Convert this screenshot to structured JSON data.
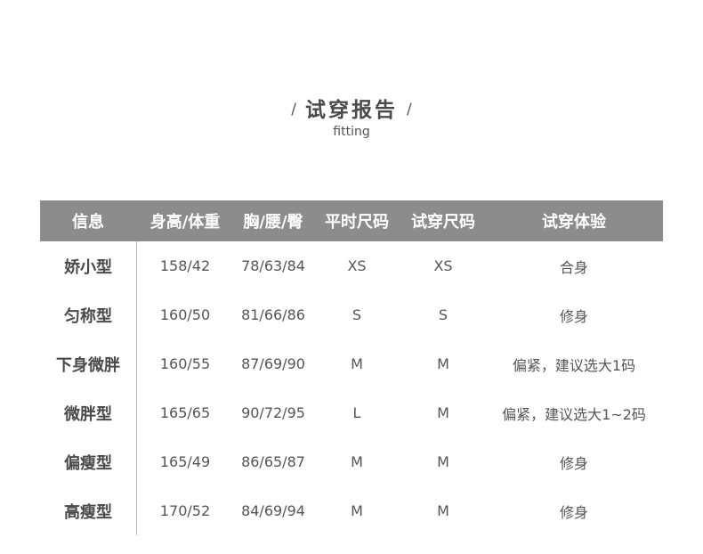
{
  "title": {
    "left_mark": "/",
    "text": "试穿报告",
    "right_mark": "/",
    "subtitle": "fitting"
  },
  "table": {
    "headers": [
      "信息",
      "身高/体重",
      "胸/腰/臀",
      "平时尺码",
      "试穿尺码",
      "试穿体验"
    ],
    "rows": [
      [
        "娇小型",
        "158/42",
        "78/63/84",
        "XS",
        "XS",
        "合身"
      ],
      [
        "匀称型",
        "160/50",
        "81/66/86",
        "S",
        "S",
        "修身"
      ],
      [
        "下身微胖",
        "160/55",
        "87/69/90",
        "M",
        "M",
        "偏紧，建议选大1码"
      ],
      [
        "微胖型",
        "165/65",
        "90/72/95",
        "L",
        "M",
        "偏紧，建议选大1~2码"
      ],
      [
        "偏瘦型",
        "165/49",
        "86/65/87",
        "M",
        "M",
        "修身"
      ],
      [
        "高瘦型",
        "170/52",
        "84/69/94",
        "M",
        "M",
        "修身"
      ]
    ]
  },
  "colors": {
    "header_bg": "#8c8c8c",
    "header_text": "#ffffff",
    "body_text": "#555555",
    "divider": "#bdbdbd"
  }
}
